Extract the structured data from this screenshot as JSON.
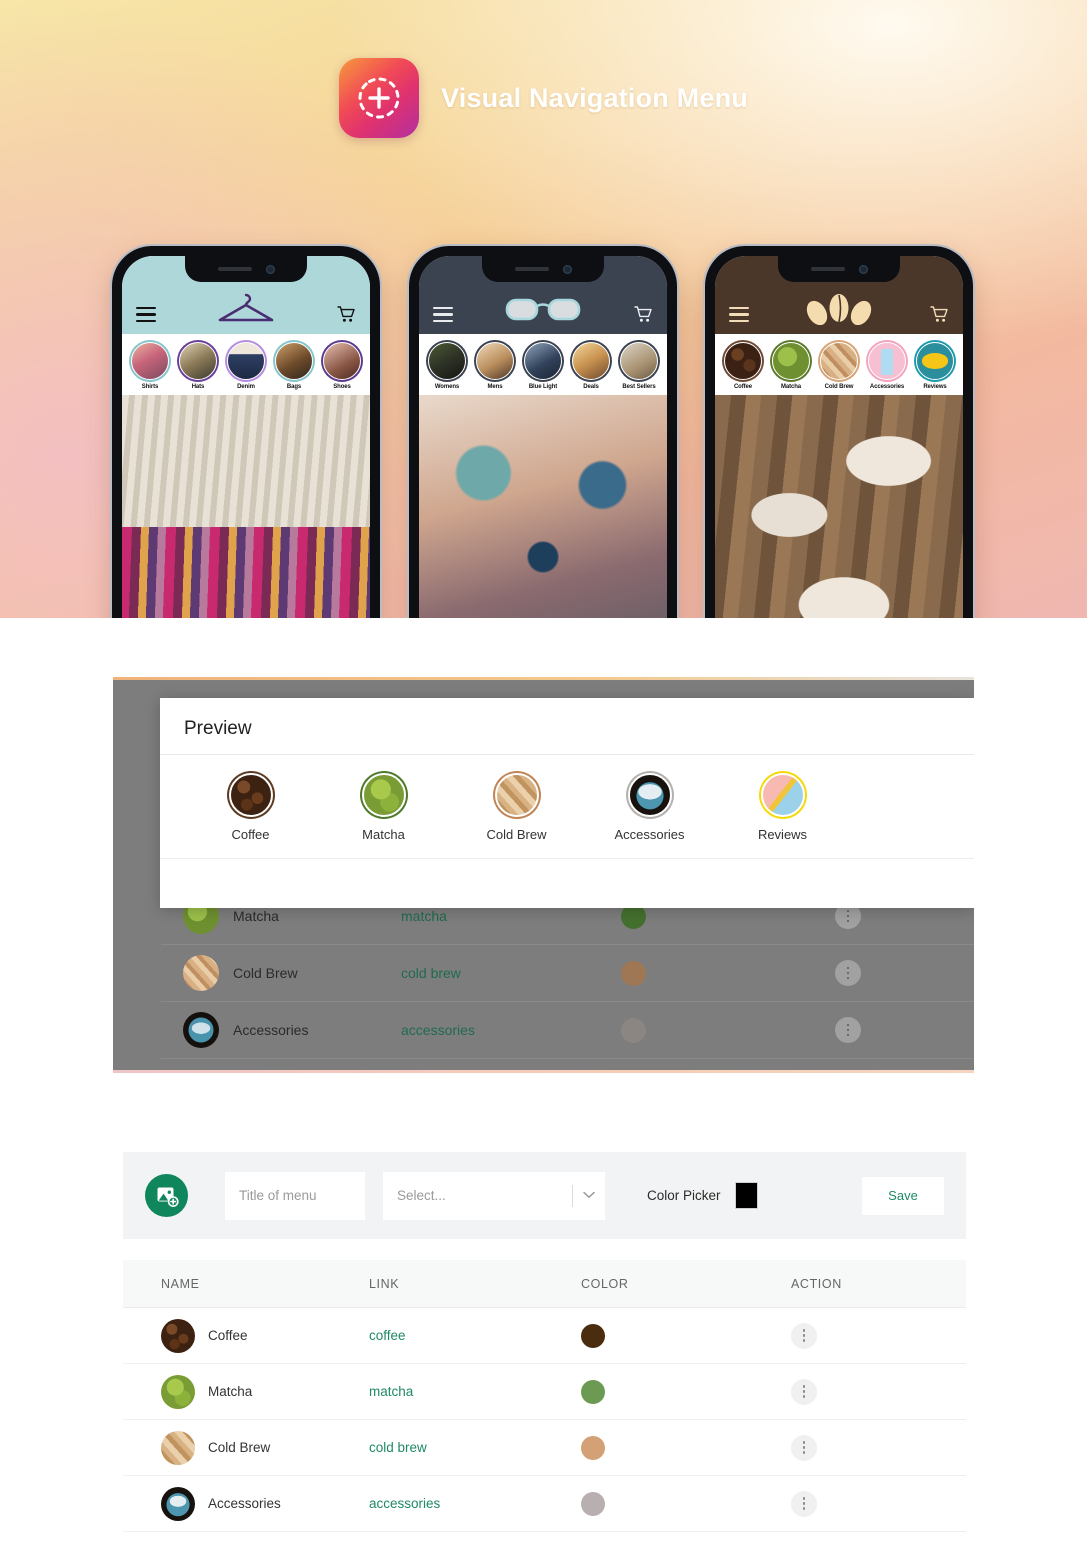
{
  "hero": {
    "title": "Visual Navigation Menu",
    "logo_icon": "camera-plus-icon"
  },
  "phones": [
    {
      "theme_color": "#aed7da",
      "brand_icon": "clothes-hanger-icon",
      "menu_icon": "hamburger-menu-icon",
      "cart_icon": "shopping-cart-icon",
      "stories": [
        {
          "label": "Shirts",
          "ring": "#86c5cc"
        },
        {
          "label": "Hats",
          "ring": "#6a3f9b"
        },
        {
          "label": "Denim",
          "ring": "#b58ce0"
        },
        {
          "label": "Bags",
          "ring": "#86c5cc"
        },
        {
          "label": "Shoes",
          "ring": "#5b3b8c"
        }
      ]
    },
    {
      "theme_color": "#3b4250",
      "brand_icon": "eyeglasses-icon",
      "menu_icon": "hamburger-menu-icon",
      "cart_icon": "shopping-cart-icon",
      "stories": [
        {
          "label": "Womens",
          "ring": "#3b4250"
        },
        {
          "label": "Mens",
          "ring": "#3b4250"
        },
        {
          "label": "Blue Light",
          "ring": "#3b4250"
        },
        {
          "label": "Deals",
          "ring": "#3b4250"
        },
        {
          "label": "Best Sellers",
          "ring": "#3b4250"
        }
      ]
    },
    {
      "theme_color": "#4a3729",
      "brand_icon": "coffee-beans-icon",
      "menu_icon": "hamburger-menu-icon",
      "cart_icon": "shopping-cart-icon",
      "stories": [
        {
          "label": "Coffee",
          "ring": "#6e4a34"
        },
        {
          "label": "Matcha",
          "ring": "#5d7a2c"
        },
        {
          "label": "Cold Brew",
          "ring": "#d9a477"
        },
        {
          "label": "Accessories",
          "ring": "#f3a3c0"
        },
        {
          "label": "Reviews",
          "ring": "#1d9aad"
        }
      ]
    }
  ],
  "dialog": {
    "title": "Preview",
    "items": [
      {
        "label": "Coffee",
        "ring": "#5b3b22"
      },
      {
        "label": "Matcha",
        "ring": "#4e7a2c"
      },
      {
        "label": "Cold Brew",
        "ring": "#c08557"
      },
      {
        "label": "Accessories",
        "ring": "#b3b0ad"
      },
      {
        "label": "Reviews",
        "ring": "#f5d90a"
      }
    ]
  },
  "scrim_table": {
    "rows": [
      {
        "name": "Matcha",
        "link": "matcha",
        "color": "#44702f",
        "kebab_icon": "more-vertical-icon"
      },
      {
        "name": "Cold Brew",
        "link": "cold brew",
        "color": "#a07754",
        "kebab_icon": "more-vertical-icon"
      },
      {
        "name": "Accessories",
        "link": "accessories",
        "color": "#8c8683",
        "kebab_icon": "more-vertical-icon"
      }
    ]
  },
  "formbar": {
    "upload_icon": "image-add-icon",
    "title_placeholder": "Title of menu",
    "title_value": "",
    "select_placeholder": "Select...",
    "select_chevron_icon": "chevron-down-icon",
    "color_picker_label": "Color Picker",
    "color_picker_value": "#000000",
    "save_label": "Save"
  },
  "table": {
    "headers": [
      "NAME",
      "LINK",
      "COLOR",
      "ACTION"
    ],
    "rows": [
      {
        "name": "Coffee",
        "link": "coffee",
        "color": "#4a2c0e",
        "kebab_icon": "more-vertical-icon"
      },
      {
        "name": "Matcha",
        "link": "matcha",
        "color": "#6d9a52",
        "kebab_icon": "more-vertical-icon"
      },
      {
        "name": "Cold Brew",
        "link": "cold brew",
        "color": "#d4a176",
        "kebab_icon": "more-vertical-icon"
      },
      {
        "name": "Accessories",
        "link": "accessories",
        "color": "#b8b0b0",
        "kebab_icon": "more-vertical-icon"
      }
    ]
  },
  "colors": {
    "brand_green": "#10865c",
    "link_green": "#1f8a63",
    "scrim": "#7d7d7d"
  }
}
